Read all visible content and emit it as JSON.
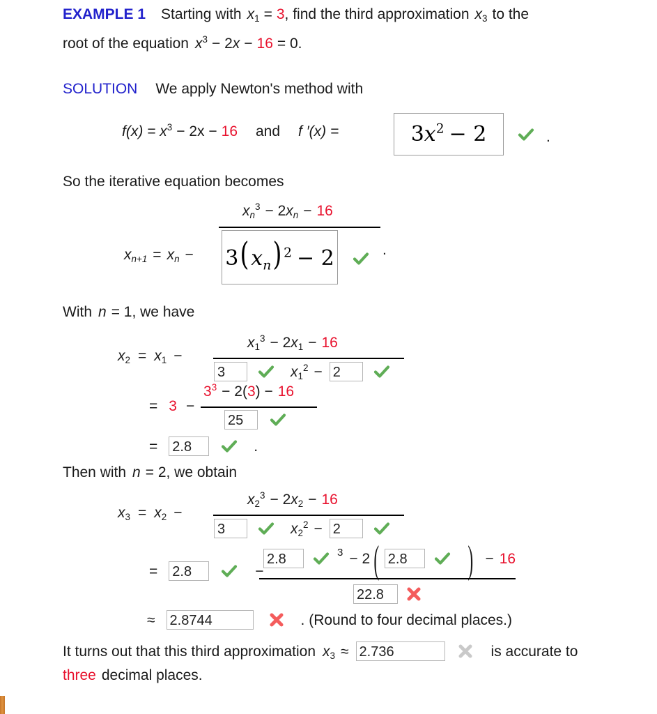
{
  "colors": {
    "red": "#e8112d",
    "blue": "#2222cc",
    "green_check": "#5fad56",
    "red_x": "#f45c5c",
    "gray_x": "#c9c9c9",
    "orange_tab": "#d1832f",
    "box_border": "#b5b5b5"
  },
  "example": {
    "label": "EXAMPLE 1",
    "line1_a": "Starting with",
    "line1_x1": "x",
    "line1_x1_sub": "1",
    "line1_eq": "=",
    "line1_val": "3",
    "line1_b": ", find the third approximation",
    "line1_x3": "x",
    "line1_x3_sub": "3",
    "line1_c": "to the",
    "line2_a": "root of the equation",
    "line2_x": "x",
    "line2_x_sup": "3",
    "line2_mid": "− 2",
    "line2_x2": "x",
    "line2_minus": "−",
    "line2_16": "16",
    "line2_end": "= 0."
  },
  "solution": {
    "label": "SOLUTION",
    "text": "We apply Newton's method with",
    "fx_label": "f(x) = x",
    "fx_sup": "3",
    "fx_mid": "− 2x −",
    "fx_16": "16",
    "and": "and",
    "fprime_label": "f ′(x) =",
    "fprime_answer_3": "3",
    "fprime_answer_x": "x",
    "fprime_answer_sup": "2",
    "fprime_answer_tail": "− 2",
    "fprime_mark": "check",
    "period": "."
  },
  "iterative": {
    "intro": "So the iterative equation becomes",
    "lhs_x": "x",
    "lhs_sub": "n+1",
    "eq": "=",
    "rhs_x": "x",
    "rhs_sub": "n",
    "minus": "−",
    "numer": {
      "x": "x",
      "x_sub": "n",
      "x_sup": "3",
      "mid": "− 2",
      "x2": "x",
      "x2_sub": "n",
      "minus": "−",
      "c16": "16"
    },
    "denom_boxed": {
      "three": "3",
      "x": "x",
      "x_sub": "n",
      "sup": "2",
      "tail": "− 2"
    },
    "mark": "check",
    "period": "."
  },
  "step_n1": {
    "intro_a": "With",
    "intro_n": "n",
    "intro_b": "= 1,  we have",
    "lhs_x": "x",
    "lhs_sub": "2",
    "eq": "=",
    "rhs_x": "x",
    "rhs_sub": "1",
    "minus": "−",
    "numer": {
      "x": "x",
      "x_sub": "1",
      "x_sup": "3",
      "mid": "− 2",
      "x2": "x",
      "x2_sub": "1",
      "minus": "−",
      "c16": "16"
    },
    "denom": {
      "coef_value": "3",
      "coef_mark": "check",
      "x": "x",
      "x_sub": "1",
      "x_sup": "2",
      "minus": "−",
      "const_value": "2",
      "const_mark": "check"
    },
    "line2": {
      "eq": "=",
      "base": "3",
      "minus": "−",
      "numer_a": "3",
      "numer_a_sup": "3",
      "numer_b": "− 2(",
      "numer_c": "3",
      "numer_d": ") −",
      "numer_16": "16",
      "denom_value": "25",
      "denom_mark": "check"
    },
    "line3": {
      "eq": "=",
      "value": "2.8",
      "mark": "check",
      "period": "."
    }
  },
  "step_n2": {
    "intro_a": "Then with",
    "intro_n": "n",
    "intro_b": "= 2, we obtain",
    "lhs_x": "x",
    "lhs_sub": "3",
    "eq": "=",
    "rhs_x": "x",
    "rhs_sub": "2",
    "minus": "−",
    "numer": {
      "x": "x",
      "x_sub": "2",
      "x_sup": "3",
      "mid": "− 2",
      "x2": "x",
      "x2_sub": "2",
      "minus": "−",
      "c16": "16"
    },
    "denom": {
      "coef_value": "3",
      "coef_mark": "check",
      "x": "x",
      "x_sub": "2",
      "x_sup": "2",
      "minus": "−",
      "const_value": "2",
      "const_mark": "check"
    },
    "line2": {
      "eq": "=",
      "base_value": "2.8",
      "base_mark": "check",
      "minus": "−",
      "numer_box1": "2.8",
      "numer_box1_mark": "check",
      "numer_sup3": "3",
      "numer_mid": "− 2",
      "lparen": "(",
      "numer_box2": "2.8",
      "numer_box2_mark": "check",
      "rparen": ")",
      "numer_tail_minus": "−",
      "numer_16": "16",
      "denom_value": "22.8",
      "denom_mark": "x-red"
    },
    "line3": {
      "approx": "≈",
      "value": "2.8744",
      "mark": "x-red",
      "note": ". (Round to four decimal places.)"
    }
  },
  "closing": {
    "line1_a": "It turns out that this third approximation",
    "line1_x": "x",
    "line1_x_sub": "3",
    "line1_approx": "≈",
    "line1_value": "2.736",
    "line1_mark": "x-gray",
    "line1_b": "is accurate to",
    "line2_red": "three",
    "line2_rest": "decimal places."
  }
}
